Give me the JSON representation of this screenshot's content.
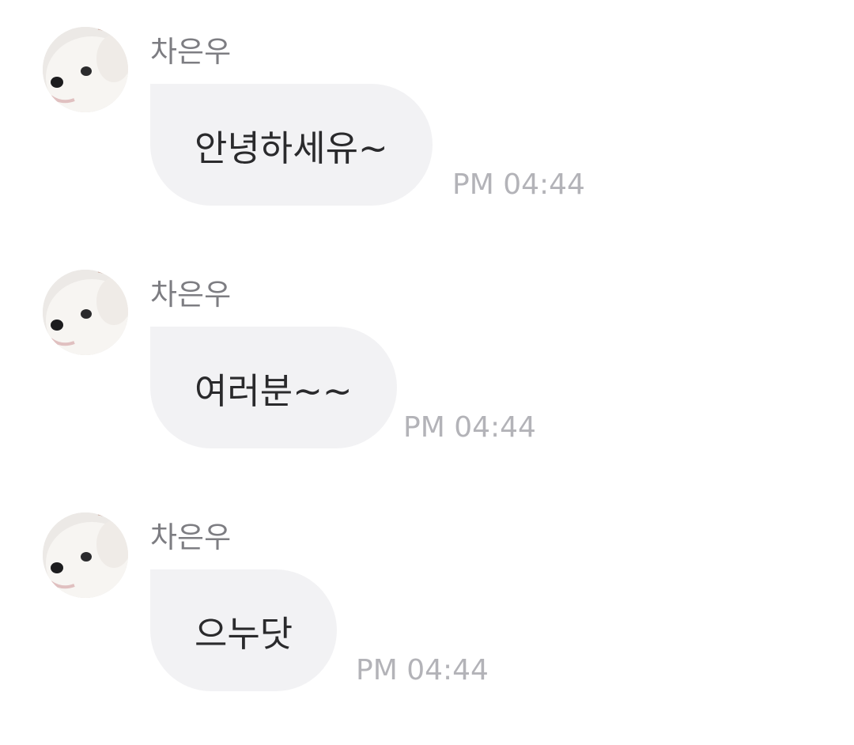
{
  "chat": {
    "messages": [
      {
        "sender": "차은우",
        "text": "안녕하세유~",
        "time": "PM 04:44"
      },
      {
        "sender": "차은우",
        "text": "여러분~~",
        "time": "PM 04:44"
      },
      {
        "sender": "차은우",
        "text": "으누닷",
        "time": "PM 04:44"
      }
    ]
  },
  "colors": {
    "bubble_background": "#f2f2f4",
    "sender_text": "#7d7d82",
    "message_text": "#2a2a2c",
    "timestamp_text": "#b3b3b8"
  },
  "icons": {
    "avatar": "white-dog-photo-avatar"
  }
}
